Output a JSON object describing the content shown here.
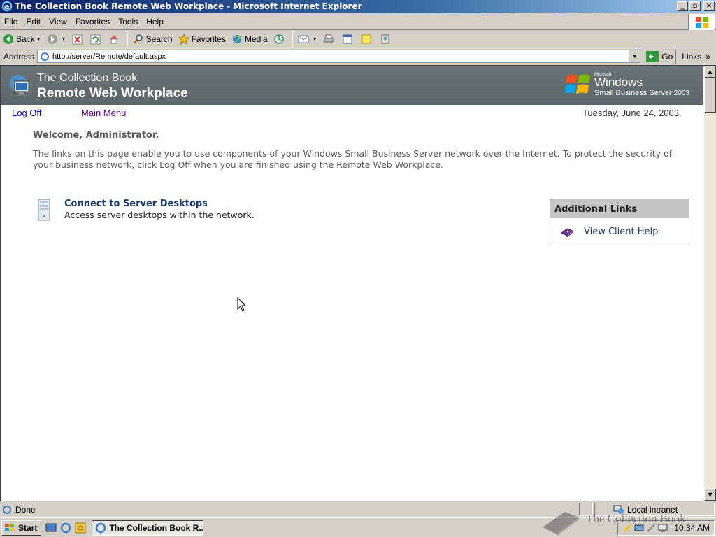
{
  "window": {
    "title": "The Collection Book Remote Web Workplace - Microsoft Internet Explorer"
  },
  "menu": {
    "items": [
      {
        "label": "File",
        "key": "F"
      },
      {
        "label": "Edit",
        "key": "E"
      },
      {
        "label": "View",
        "key": "V"
      },
      {
        "label": "Favorites",
        "key": "a"
      },
      {
        "label": "Tools",
        "key": "T"
      },
      {
        "label": "Help",
        "key": "H"
      }
    ]
  },
  "toolbar": {
    "back": "Back",
    "search": "Search",
    "favorites": "Favorites",
    "media": "Media"
  },
  "address": {
    "label": "Address",
    "url": "http://server/Remote/default.aspx",
    "go": "Go",
    "links": "Links"
  },
  "banner": {
    "company": "The Collection Book",
    "product": "Remote Web Workplace",
    "brand_ms": "Microsoft",
    "brand_windows": "Windows",
    "brand_sbs": "Small Business Server",
    "brand_year": "2003"
  },
  "nav": {
    "logoff": "Log Off",
    "mainmenu": "Main Menu",
    "date": "Tuesday, June 24, 2003"
  },
  "main": {
    "welcome": "Welcome, Administrator.",
    "intro": "The links on this page enable you to use components of your Windows Small Business Server network over the Internet. To protect the security of your business network, click Log Off when you are finished using the Remote Web Workplace.",
    "connect_title": "Connect to Server Desktops",
    "connect_desc": "Access server desktops within the network."
  },
  "additional_links": {
    "header": "Additional Links",
    "item": "View Client Help"
  },
  "status": {
    "text": "Done",
    "zone": "Local intranet"
  },
  "taskbar": {
    "start": "Start",
    "task": "The Collection Book R...",
    "clock": "10:34 AM"
  },
  "watermark": {
    "text": "The Collection Book"
  },
  "colors": {
    "banner": "#5c6669",
    "titlebar": "#0a246a",
    "link": "#0000cc",
    "visited": "#660099"
  }
}
